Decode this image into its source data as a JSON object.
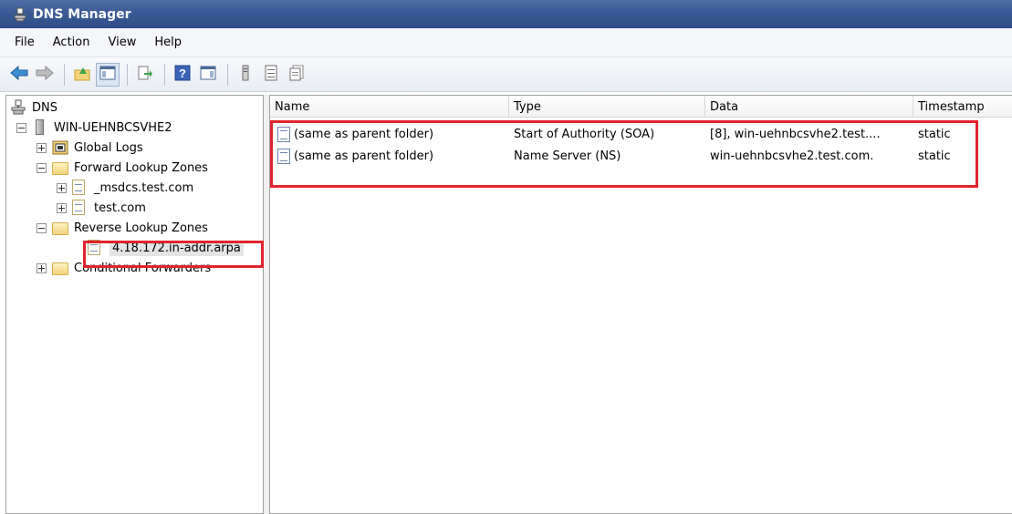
{
  "window": {
    "title": "DNS Manager"
  },
  "menu": [
    "File",
    "Action",
    "View",
    "Help"
  ],
  "toolbar": {
    "icons": [
      "back-arrow-icon",
      "forward-arrow-icon",
      "up-folder-icon",
      "show-hide-tree-icon",
      "export-list-icon",
      "help-icon",
      "action-pane-icon",
      "server-icon",
      "record-list-icon",
      "properties-icon"
    ]
  },
  "tree": {
    "root": "DNS",
    "server": "WIN-UEHNBCSVHE2",
    "global_logs": "Global Logs",
    "forward_zones": "Forward Lookup Zones",
    "fwd_zone_1": "_msdcs.test.com",
    "fwd_zone_2": "test.com",
    "reverse_zones": "Reverse Lookup Zones",
    "rev_zone_1": "4.18.172.in-addr.arpa",
    "conditional_forwarders": "Conditional Forwarders"
  },
  "list": {
    "columns": [
      "Name",
      "Type",
      "Data",
      "Timestamp"
    ],
    "rows": [
      {
        "name": "(same as parent folder)",
        "type": "Start of Authority (SOA)",
        "data": "[8], win-uehnbcsvhe2.test....",
        "timestamp": "static"
      },
      {
        "name": "(same as parent folder)",
        "type": "Name Server (NS)",
        "data": "win-uehnbcsvhe2.test.com.",
        "timestamp": "static"
      }
    ]
  },
  "colors": {
    "highlight": "#e0242c",
    "titlebar": "#3b5a95"
  }
}
